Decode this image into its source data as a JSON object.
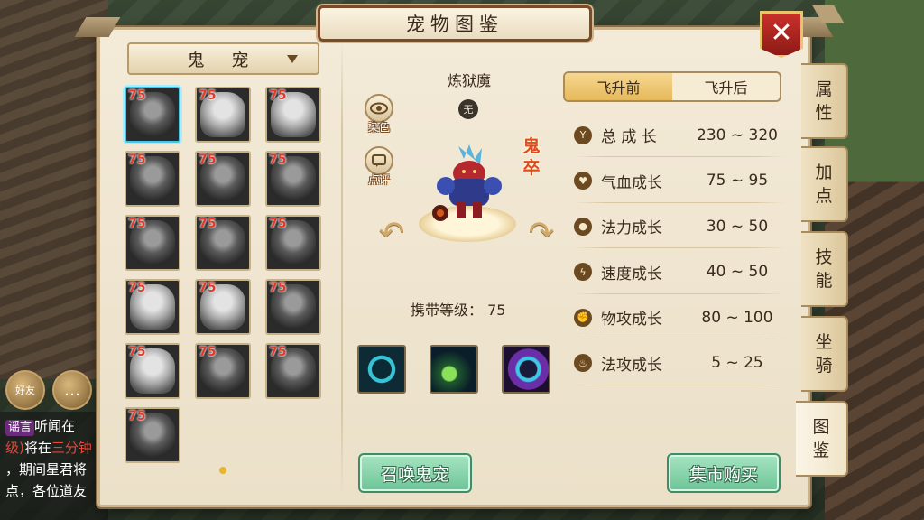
{
  "window": {
    "title": "宠物图鉴",
    "close_label": "✕"
  },
  "category_dropdown": {
    "selected": "鬼  宠"
  },
  "pet_list": [
    {
      "level": "75",
      "selected": true,
      "tone": "dark"
    },
    {
      "level": "75",
      "selected": false,
      "tone": "light"
    },
    {
      "level": "75",
      "selected": false,
      "tone": "light"
    },
    {
      "level": "75",
      "selected": false,
      "tone": "dark"
    },
    {
      "level": "75",
      "selected": false,
      "tone": "dark"
    },
    {
      "level": "75",
      "selected": false,
      "tone": "dark"
    },
    {
      "level": "75",
      "selected": false,
      "tone": "dark"
    },
    {
      "level": "75",
      "selected": false,
      "tone": "dark"
    },
    {
      "level": "75",
      "selected": false,
      "tone": "dark"
    },
    {
      "level": "75",
      "selected": false,
      "tone": "light"
    },
    {
      "level": "75",
      "selected": false,
      "tone": "light"
    },
    {
      "level": "75",
      "selected": false,
      "tone": "dark"
    },
    {
      "level": "75",
      "selected": false,
      "tone": "light"
    },
    {
      "level": "75",
      "selected": false,
      "tone": "dark"
    },
    {
      "level": "75",
      "selected": false,
      "tone": "dark"
    },
    {
      "level": "75",
      "selected": false,
      "tone": "dark"
    }
  ],
  "pet_detail": {
    "name": "炼狱魔",
    "element_badge": "无",
    "type_label": "鬼卒",
    "dye_label": "染色",
    "comment_label": "点评",
    "carry_level_label": "携带等级：",
    "carry_level_value": "75",
    "skill_icons": [
      "ring-skill-icon",
      "burst-skill-icon",
      "shield-skill-icon"
    ]
  },
  "growth_tabs": {
    "before": "飞升前",
    "after": "飞升后",
    "active": "before"
  },
  "stats": [
    {
      "icon": "growth-icon",
      "glyph": "Y",
      "label": "总 成 长",
      "value": "230 ~ 320"
    },
    {
      "icon": "heart-icon",
      "glyph": "♥",
      "label": "气血成长",
      "value": "75 ~ 95"
    },
    {
      "icon": "drop-icon",
      "glyph": "●",
      "label": "法力成长",
      "value": "30 ~ 50"
    },
    {
      "icon": "speed-icon",
      "glyph": "ϟ",
      "label": "速度成长",
      "value": "40 ~ 50"
    },
    {
      "icon": "fist-icon",
      "glyph": "✊",
      "label": "物攻成长",
      "value": "80 ~ 100"
    },
    {
      "icon": "flame-icon",
      "glyph": "♨",
      "label": "法攻成长",
      "value": "5 ~ 25"
    }
  ],
  "buttons": {
    "summon": "召唤鬼宠",
    "market": "集市购买"
  },
  "side_tabs": [
    {
      "label": "属性",
      "active": false
    },
    {
      "label": "加点",
      "active": false
    },
    {
      "label": "技能",
      "active": false
    },
    {
      "label": "坐骑",
      "active": false
    },
    {
      "label": "图鉴",
      "active": true
    }
  ],
  "chat": {
    "friend_label": "好友",
    "tag": "谣言",
    "line1": "听闻在",
    "line2a": "级)",
    "line2b": "将在",
    "line2c": "三分钟",
    "line3": "，期间星君将",
    "line4": "点，各位道友"
  }
}
